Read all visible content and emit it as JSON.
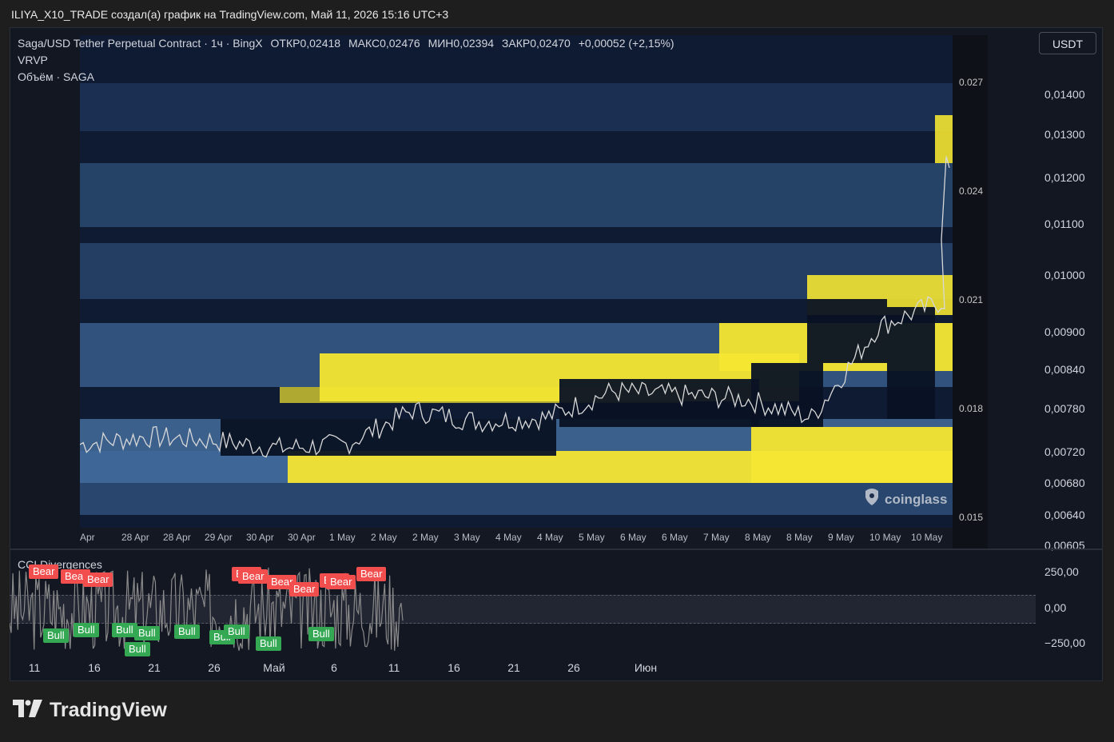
{
  "header": {
    "title": "ILIYA_X10_TRADE создал(а) график на TradingView.com, Май 11, 2026 15:16 UTC+3"
  },
  "legend": {
    "symbol": "Saga/USD Tether Perpetual Contract · 1ч · BingX",
    "open": "ОТКР0,02418",
    "high": "МАКС0,02476",
    "low": "МИН0,02394",
    "close": "ЗАКР0,02470",
    "change": "+0,00052 (+2,15%)",
    "indicator1": "VRVP",
    "indicator2": "Объём · SAGA"
  },
  "currency_button": "USDT",
  "heatmap": {
    "axis_ticks": [
      "0.027",
      "0.024",
      "0.021",
      "0.018",
      "0.015"
    ],
    "dates": [
      "Apr",
      "28 Apr",
      "28 Apr",
      "29 Apr",
      "30 Apr",
      "30 Apr",
      "1 May",
      "2 May",
      "2 May",
      "3 May",
      "4 May",
      "4 May",
      "5 May",
      "6 May",
      "6 May",
      "7 May",
      "8 May",
      "8 May",
      "9 May",
      "10 May",
      "10 May"
    ],
    "watermark": "coinglass",
    "colors": {
      "low": "#0f1b33",
      "mid": "#3f6b9e",
      "high": "#f4e632",
      "line": "#d8d8d8"
    }
  },
  "price_axis": {
    "labels": [
      "0,01400",
      "0,01300",
      "0,01200",
      "0,01100",
      "0,01000",
      "0,00900",
      "0,00840",
      "0,00780",
      "0,00720",
      "0,00680",
      "0,00640",
      "0,00605"
    ]
  },
  "cci": {
    "title": "CCI Divergences",
    "axis_labels": [
      "250,00",
      "0,00",
      "−250,00"
    ],
    "bear_label": "Bear",
    "bull_label": "Bull",
    "colors": {
      "bear": "#f24e4e",
      "bull": "#34a853",
      "line": "#8a8a8a"
    }
  },
  "time_axis": {
    "labels": [
      "11",
      "16",
      "21",
      "26",
      "Май",
      "6",
      "11",
      "16",
      "21",
      "26",
      "Июн"
    ]
  },
  "brand": {
    "name": "TradingView"
  },
  "chart_data": {
    "type": "heatmap",
    "title": "Saga/USD Tether Perpetual Contract · 1ч · BingX",
    "description_series": [
      {
        "name": "Price",
        "x": [
          "Apr",
          "28 Apr",
          "29 Apr",
          "30 Apr",
          "1 May",
          "2 May",
          "3 May",
          "4 May",
          "5 May",
          "6 May",
          "7 May",
          "8 May",
          "9 May",
          "10 May"
        ],
        "values": [
          0.0172,
          0.0174,
          0.0173,
          0.0171,
          0.0172,
          0.0181,
          0.0178,
          0.0179,
          0.0186,
          0.0185,
          0.0184,
          0.0179,
          0.0203,
          0.021
        ]
      },
      {
        "name": "CCI Divergences",
        "x": [
          "11",
          "16",
          "21",
          "26",
          "Май",
          "6",
          "11"
        ],
        "values": [
          80,
          40,
          -60,
          20,
          120,
          60,
          150
        ]
      }
    ],
    "ylim": [
      0.015,
      0.028
    ],
    "cci_ylim": [
      -250,
      250
    ]
  }
}
